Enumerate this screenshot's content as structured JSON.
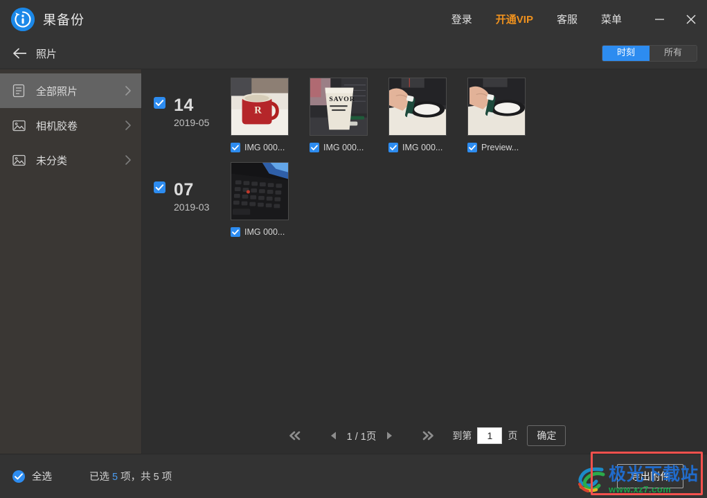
{
  "window": {
    "app_name": "果备份",
    "logo_icon": "info-circle-refresh-icon",
    "menu": [
      {
        "label": "登录",
        "name": "login",
        "accent": false
      },
      {
        "label": "开通VIP",
        "name": "vip",
        "accent": true
      },
      {
        "label": "客服",
        "name": "support",
        "accent": false
      },
      {
        "label": "菜单",
        "name": "menu",
        "accent": false
      }
    ],
    "minimize_icon": "minimize-icon",
    "close_icon": "close-icon"
  },
  "subheader": {
    "back_icon": "back-arrow-icon",
    "title": "照片",
    "segments": [
      {
        "label": "时刻",
        "active": true
      },
      {
        "label": "所有",
        "active": false
      }
    ]
  },
  "sidebar": {
    "items": [
      {
        "label": "全部照片",
        "icon": "document-list-icon",
        "active": true
      },
      {
        "label": "相机胶卷",
        "icon": "image-icon",
        "active": false
      },
      {
        "label": "未分类",
        "icon": "image-icon",
        "active": false
      }
    ]
  },
  "groups": [
    {
      "day": "14",
      "month": "2019-05",
      "checked": true,
      "tiles": [
        {
          "label": "IMG 000...",
          "checked": true,
          "thumb": "red-mug-photo"
        },
        {
          "label": "IMG 000...",
          "checked": true,
          "thumb": "savor-mug-photo"
        },
        {
          "label": "IMG 000...",
          "checked": true,
          "thumb": "hand-battery-photo"
        },
        {
          "label": "Preview...",
          "checked": true,
          "thumb": "hand-battery-photo-2"
        }
      ]
    },
    {
      "day": "07",
      "month": "2019-03",
      "checked": true,
      "tiles": [
        {
          "label": "IMG 000...",
          "checked": true,
          "thumb": "laptop-keyboard-photo"
        }
      ]
    }
  ],
  "pager": {
    "first_icon": "double-chevron-left-icon",
    "prev_icon": "chevron-left-icon",
    "page_text": "1 / 1页",
    "next_icon": "chevron-right-icon",
    "last_icon": "double-chevron-right-icon",
    "goto_label": "到第",
    "page_value": "1",
    "page_unit": "页",
    "confirm_label": "确定"
  },
  "bottom": {
    "select_all_label": "全选",
    "select_all_checked": true,
    "count_prefix": "已选",
    "count_selected": "5",
    "count_middle": "项，共",
    "count_total": "5",
    "count_suffix": "项",
    "export_label": "导出附件"
  },
  "watermark": {
    "cn": "极光下载站",
    "url": "www.xz7.com"
  },
  "colors": {
    "accent_blue": "#2d8cf0",
    "vip_orange": "#f0921e",
    "annotation_red": "#f4514d",
    "titlebar_bg": "#343434",
    "sidebar_bg": "#3a3734",
    "content_bg": "#2e2e2e",
    "bottom_bg": "#333333"
  }
}
